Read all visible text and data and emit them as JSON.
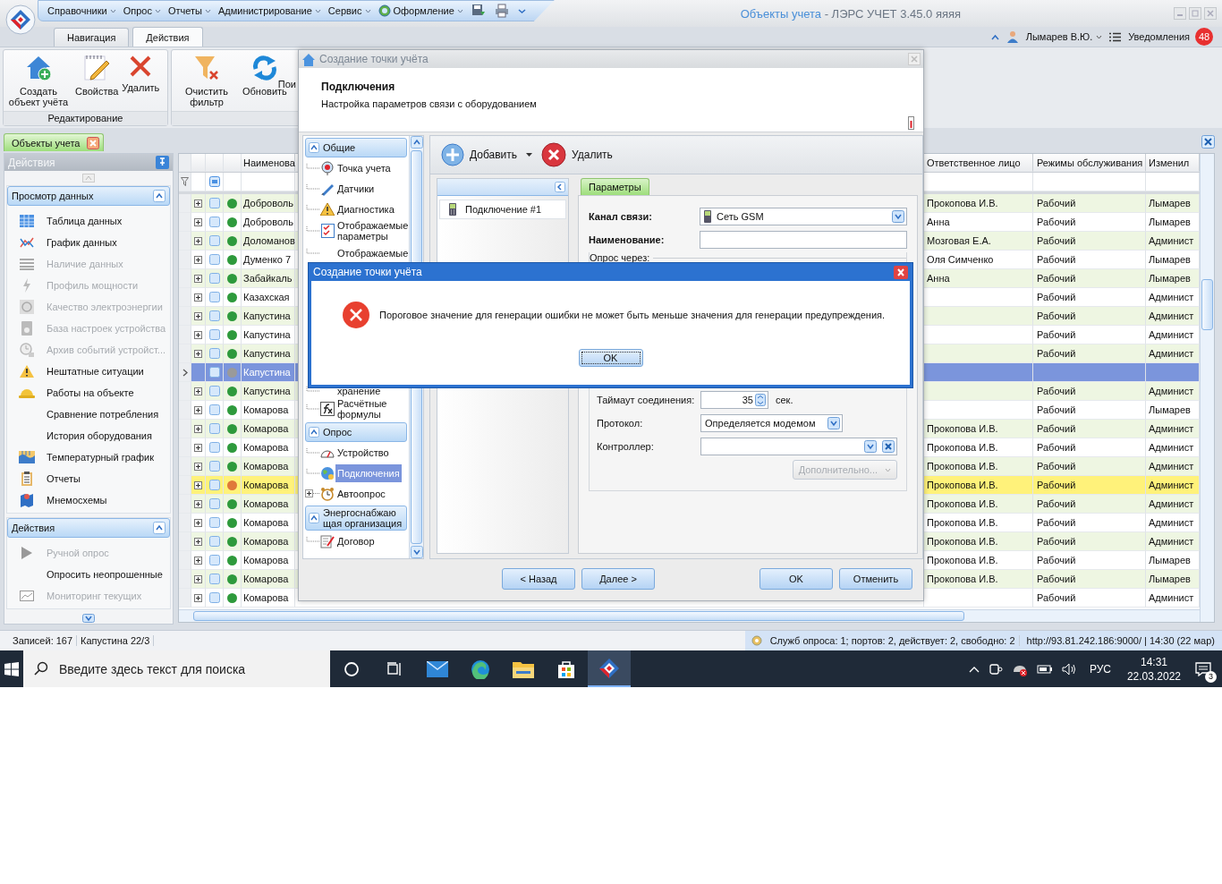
{
  "app": {
    "menu": [
      {
        "label": "Справочники"
      },
      {
        "label": "Опрос"
      },
      {
        "label": "Отчеты"
      },
      {
        "label": "Администрирование"
      },
      {
        "label": "Сервис"
      },
      {
        "label": "Оформление"
      }
    ],
    "title_document": "Объекты учета",
    "title_app": " - ЛЭРС УЧЕТ 3.45.0 яяяя"
  },
  "ribbon": {
    "tabs": [
      {
        "label": "Навигация",
        "selected": false
      },
      {
        "label": "Действия",
        "selected": true
      }
    ],
    "user": "Лымарев В.Ю.",
    "notifications": "Уведомления",
    "notification_count": "48",
    "groups": [
      {
        "caption": "Редактирование",
        "buttons": [
          {
            "label": "Создать объект учёта"
          },
          {
            "label": "Свойства"
          },
          {
            "label": "Удалить"
          }
        ]
      },
      {
        "buttons": [
          {
            "label": "Очистить фильтр"
          },
          {
            "label": "Обновить"
          },
          {
            "label": "Пои"
          }
        ]
      }
    ]
  },
  "doc_tab": {
    "label": "Объекты учета",
    "selected": true
  },
  "left_panel": {
    "title": "Действия",
    "sections": [
      {
        "title": "Просмотр данных",
        "expanded": true,
        "items": [
          {
            "label": "Таблица данных",
            "disabled": false
          },
          {
            "label": "График данных",
            "disabled": false
          },
          {
            "label": "Наличие данных",
            "disabled": true
          },
          {
            "label": "Профиль мощности",
            "disabled": true
          },
          {
            "label": "Качество электроэнергии",
            "disabled": true
          },
          {
            "label": "База настроек устройства",
            "disabled": true
          },
          {
            "label": "Архив событий устройст...",
            "disabled": true
          },
          {
            "label": "Нештатные ситуации",
            "disabled": false
          },
          {
            "label": "Работы на объекте",
            "disabled": false
          },
          {
            "label": "Сравнение потребления",
            "disabled": false
          },
          {
            "label": "История оборудования",
            "disabled": false
          },
          {
            "label": "Температурный график",
            "disabled": false
          },
          {
            "label": "Отчеты",
            "disabled": false
          },
          {
            "label": "Мнемосхемы",
            "disabled": false
          }
        ]
      },
      {
        "title": "Действия",
        "expanded": true,
        "items": [
          {
            "label": "Ручной опрос",
            "disabled": true
          },
          {
            "label": "Опросить неопрошенные",
            "disabled": false
          },
          {
            "label": "Мониторинг текущих",
            "disabled": true
          }
        ]
      }
    ]
  },
  "grid": {
    "columns_left": [
      "Наименова"
    ],
    "columns_right": [
      "Ответственное лицо",
      "Режимы обслуживания",
      "Изменил"
    ],
    "rows": [
      {
        "name": "Доброволь",
        "responsible": "Прокопова И.В.",
        "mode": "Рабочий",
        "changed_by": "Лымарев",
        "color": "#2e9a3c",
        "selected": false,
        "highlighted": false,
        "expandable": true
      },
      {
        "name": "Доброволь",
        "responsible": "Анна",
        "mode": "Рабочий",
        "changed_by": "Лымарев",
        "color": "#2e9a3c",
        "selected": false,
        "highlighted": false,
        "expandable": true
      },
      {
        "name": "Доломанов",
        "responsible": "Мозговая Е.А.",
        "mode": "Рабочий",
        "changed_by": "Админист",
        "color": "#2e9a3c",
        "selected": false,
        "highlighted": false,
        "expandable": true
      },
      {
        "name": "Думенко 7",
        "responsible": "Оля Симченко",
        "mode": "Рабочий",
        "changed_by": "Лымарев",
        "color": "#2e9a3c",
        "selected": false,
        "highlighted": false,
        "expandable": true
      },
      {
        "name": "Забайкаль",
        "responsible": "Анна",
        "mode": "Рабочий",
        "changed_by": "Лымарев",
        "color": "#2e9a3c",
        "selected": false,
        "highlighted": false,
        "expandable": true
      },
      {
        "name": "Казахская",
        "mode": "Рабочий",
        "changed_by": "Админист",
        "color": "#2e9a3c",
        "selected": false,
        "highlighted": false,
        "expandable": true
      },
      {
        "name": "Капустина",
        "mode": "Рабочий",
        "changed_by": "Админист",
        "color": "#2e9a3c",
        "selected": false,
        "highlighted": false,
        "expandable": true
      },
      {
        "name": "Капустина",
        "mode": "Рабочий",
        "changed_by": "Админист",
        "color": "#2e9a3c",
        "selected": false,
        "highlighted": false,
        "expandable": true
      },
      {
        "name": "Капустина",
        "mode": "Рабочий",
        "changed_by": "Админист",
        "color": "#2e9a3c",
        "selected": false,
        "highlighted": false,
        "expandable": true
      },
      {
        "name": "Капустина",
        "color": "#9a9a9a",
        "selected": true,
        "highlighted": false,
        "expandable": false
      },
      {
        "name": "Капустина",
        "mode": "Рабочий",
        "changed_by": "Админист",
        "color": "#2e9a3c",
        "selected": false,
        "highlighted": false,
        "expandable": true
      },
      {
        "name": "Комарова",
        "mode": "Рабочий",
        "changed_by": "Лымарев",
        "color": "#2e9a3c",
        "selected": false,
        "highlighted": false,
        "expandable": true
      },
      {
        "name": "Комарова",
        "responsible": "Прокопова И.В.",
        "mode": "Рабочий",
        "changed_by": "Админист",
        "color": "#2e9a3c",
        "selected": false,
        "highlighted": false,
        "expandable": true
      },
      {
        "name": "Комарова",
        "responsible": "Прокопова И.В.",
        "mode": "Рабочий",
        "changed_by": "Админист",
        "color": "#2e9a3c",
        "selected": false,
        "highlighted": false,
        "expandable": true
      },
      {
        "name": "Комарова",
        "responsible": "Прокопова И.В.",
        "mode": "Рабочий",
        "changed_by": "Админист",
        "color": "#2e9a3c",
        "selected": false,
        "highlighted": false,
        "expandable": true
      },
      {
        "name": "Комарова",
        "responsible": "Прокопова И.В.",
        "mode": "Рабочий",
        "changed_by": "Админист",
        "color": "#e0783a",
        "selected": false,
        "highlighted": true,
        "expandable": true
      },
      {
        "name": "Комарова",
        "responsible": "Прокопова И.В.",
        "mode": "Рабочий",
        "changed_by": "Админист",
        "color": "#2e9a3c",
        "selected": false,
        "highlighted": false,
        "expandable": true
      },
      {
        "name": "Комарова",
        "responsible": "Прокопова И.В.",
        "mode": "Рабочий",
        "changed_by": "Админист",
        "color": "#2e9a3c",
        "selected": false,
        "highlighted": false,
        "expandable": true
      },
      {
        "name": "Комарова",
        "responsible": "Прокопова И.В.",
        "mode": "Рабочий",
        "changed_by": "Админист",
        "color": "#2e9a3c",
        "selected": false,
        "highlighted": false,
        "expandable": true
      },
      {
        "name": "Комарова",
        "responsible": "Прокопова И.В.",
        "mode": "Рабочий",
        "changed_by": "Лымарев",
        "color": "#2e9a3c",
        "selected": false,
        "highlighted": false,
        "expandable": true
      },
      {
        "name": "Комарова",
        "responsible": "Прокопова И.В.",
        "mode": "Рабочий",
        "changed_by": "Лымарев",
        "color": "#2e9a3c",
        "selected": false,
        "highlighted": false,
        "expandable": true
      },
      {
        "name": "Комарова",
        "mode": "Рабочий",
        "changed_by": "Админист",
        "color": "#2e9a3c",
        "selected": false,
        "highlighted": false,
        "expandable": true
      }
    ]
  },
  "dialog": {
    "title": "Создание точки учёта",
    "header_title": "Подключения",
    "header_subtitle": "Настройка параметров связи с оборудованием",
    "tree": [
      {
        "title": "Общие",
        "expanded": true,
        "items": [
          {
            "label": "Точка учета",
            "selected": false,
            "expandable": false
          },
          {
            "label": "Датчики",
            "selected": false,
            "expandable": false
          },
          {
            "label": "Диагностика",
            "selected": false,
            "expandable": false
          },
          {
            "label": "Отображаемые параметры",
            "selected": false,
            "expandable": false
          },
          {
            "label": "Отображаемые",
            "selected": false,
            "expandable": false
          },
          {
            "label": "хранение",
            "selected": false,
            "expandable": false
          },
          {
            "label": "Расчётные формулы",
            "selected": false,
            "expandable": false
          }
        ]
      },
      {
        "title": "Опрос",
        "expanded": true,
        "items": [
          {
            "label": "Устройство",
            "selected": false,
            "expandable": false
          },
          {
            "label": "Подключения",
            "selected": true,
            "expandable": false
          },
          {
            "label": "Автоопрос",
            "selected": false,
            "expandable": true
          }
        ]
      },
      {
        "title": "Энергоснабжающая организация",
        "expanded": true,
        "items": [
          {
            "label": "Договор",
            "selected": false,
            "expandable": false
          }
        ]
      }
    ],
    "add": "Добавить",
    "delete": "Удалить",
    "connections": [
      {
        "label": "Подключение #1"
      }
    ],
    "tabs": [
      {
        "label": "Параметры",
        "selected": true
      }
    ],
    "form": {
      "channel_label": "Канал связи:",
      "channel_value": "Сеть GSM",
      "name_label": "Наименование:",
      "poll_via": "Опрос через:",
      "timeout_label": "Таймаут соединения:",
      "timeout_value": "35",
      "timeout_unit": "сек.",
      "protocol_label": "Протокол:",
      "protocol_value": "Определяется модемом",
      "controller_label": "Контроллер:",
      "more": {
        "label": "Дополнительно...",
        "disabled": true
      }
    },
    "back": "< Назад",
    "next": "Далее >",
    "ok": "OK",
    "cancel": "Отменить"
  },
  "message": {
    "title": "Создание точки учёта",
    "text": "Пороговое значение для генерации ошибки не может быть меньше значения для генерации предупреждения.",
    "ok": "OK"
  },
  "status_bar": {
    "records": "Записей: 167",
    "current": "Капустина 22/3",
    "services": "Служб опроса: 1; портов: 2, действует: 2, свободно: 2",
    "server": "http://93.81.242.186:9000/ | 14:30 (22 мар)"
  },
  "taskbar": {
    "search_placeholder": "Введите здесь текст для поиска",
    "apps": [
      {
        "selected": false
      },
      {
        "selected": false
      },
      {
        "selected": false
      },
      {
        "selected": false
      },
      {
        "selected": false
      },
      {
        "selected": false
      },
      {
        "selected": true
      }
    ],
    "language": "РУС",
    "time": "14:31",
    "date": "22.03.2022",
    "notification_count": "3"
  }
}
